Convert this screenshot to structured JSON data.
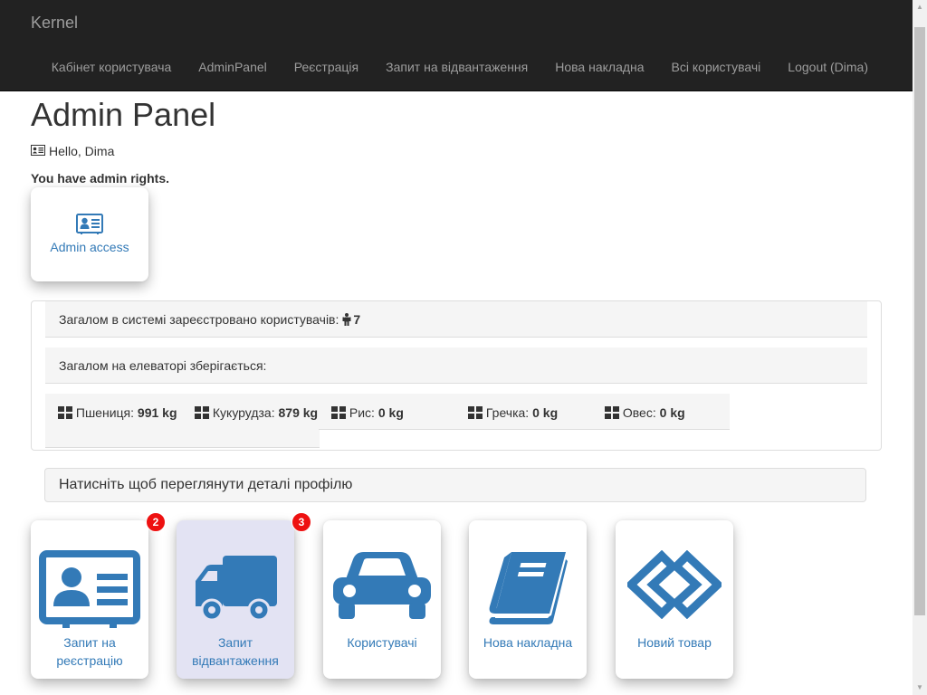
{
  "navbar": {
    "brand": "Kernel",
    "links": [
      "Кабінет користувача",
      "AdminPanel",
      "Реєстрація",
      "Запит на відвантаження",
      "Нова накладна",
      "Всі користувачі",
      "Logout (Dima)"
    ]
  },
  "page": {
    "title": "Admin Panel",
    "greeting": "Hello, Dima",
    "admin_note": "You have admin rights.",
    "admin_tile_label": "Admin access"
  },
  "stats": {
    "users_label": "Загалом в системі зареєстровано користувачів:",
    "users_count": "7",
    "storage_label": "Загалом на елеваторі зберігається:",
    "grains": [
      {
        "name": "Пшениця:",
        "amount": "991",
        "unit": "kg"
      },
      {
        "name": "Кукурудза:",
        "amount": "879",
        "unit": "kg"
      },
      {
        "name": "Рис:",
        "amount": "0",
        "unit": "kg"
      },
      {
        "name": "Гречка:",
        "amount": "0",
        "unit": "kg"
      },
      {
        "name": "Овес:",
        "amount": "0",
        "unit": "kg"
      }
    ]
  },
  "details_prompt": "Натисніть щоб переглянути деталі профілю",
  "tiles": [
    {
      "label": "Запит на реєстрацію",
      "icon": "id-card-icon",
      "badge": "2"
    },
    {
      "label": "Запит відвантаження",
      "icon": "truck-icon",
      "badge": "3"
    },
    {
      "label": "Користувачі",
      "icon": "car-icon"
    },
    {
      "label": "Нова накладна",
      "icon": "book-icon"
    },
    {
      "label": "Новий товар",
      "icon": "link-icon"
    }
  ],
  "colors": {
    "navbar_bg": "#222222",
    "nav_text": "#9d9d9d",
    "accent_blue": "#337ab7",
    "badge_red": "#ee1111",
    "active_tile_bg": "#e3e3f3"
  }
}
